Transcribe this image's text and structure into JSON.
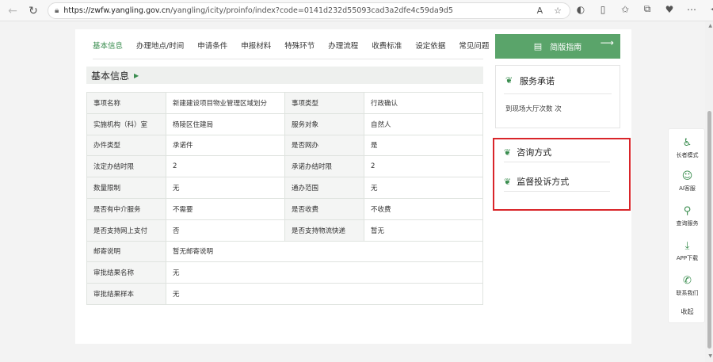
{
  "browser": {
    "url_host": "https://zwfw.yangling.gov.cn",
    "url_path": "/yangling/icity/proinfo/index?code=0141d232d55093cad3a2dfe4c59da9d5"
  },
  "tabs": [
    "基本信息",
    "办理地点/时间",
    "申请条件",
    "申报材料",
    "特殊环节",
    "办理流程",
    "收费标准",
    "设定依据",
    "常见问题"
  ],
  "section_title": "基本信息",
  "table": {
    "rows4": [
      [
        "事项名称",
        "新建建设项目物业管理区域划分",
        "事项类型",
        "行政确认"
      ],
      [
        "实施机构（科）室",
        "杨陵区住建局",
        "服务对象",
        "自然人"
      ],
      [
        "办件类型",
        "承诺件",
        "是否网办",
        "是"
      ],
      [
        "法定办结时限",
        "2",
        "承诺办结时限",
        "2"
      ],
      [
        "数量限制",
        "无",
        "通办范围",
        "无"
      ],
      [
        "是否有中介服务",
        "不需要",
        "是否收费",
        "不收费"
      ],
      [
        "是否支持网上支付",
        "否",
        "是否支持物流快递",
        "暂无"
      ]
    ],
    "rows2": [
      [
        "邮寄说明",
        "暂无邮寄说明"
      ],
      [
        "审批结果名称",
        "无"
      ],
      [
        "审批结果样本",
        "无"
      ]
    ]
  },
  "right": {
    "guide_label": "简版指南",
    "guide_arrow": "⟶",
    "service_title": "服务承诺",
    "service_text": "到现场大厅次数  次",
    "consult_title": "咨询方式",
    "complaint_title": "监督投诉方式"
  },
  "float_bar": {
    "items": [
      "长者模式",
      "AI客服",
      "查询服务",
      "APP下载",
      "联系我们"
    ],
    "collapse": "收起"
  },
  "colors": {
    "accent": "#3a8d4f",
    "guide_button": "#5aa46a",
    "highlight_border": "#d9252a"
  }
}
